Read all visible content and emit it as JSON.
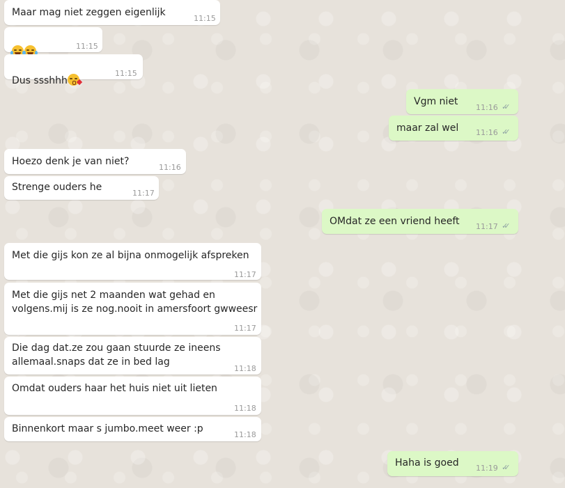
{
  "messages": [
    {
      "dir": "in",
      "text": "Maar mag niet zeggen eigenlijk",
      "time": "11:15"
    },
    {
      "dir": "in",
      "emoji": [
        "face-with-tears-of-joy-icon",
        "face-with-tears-of-joy-icon"
      ],
      "text": "",
      "time": "11:15"
    },
    {
      "dir": "in",
      "text": "Dus ssshhh",
      "emoji_after": "face-blowing-kiss-icon",
      "time": "11:15"
    },
    {
      "dir": "out",
      "text": "Vgm niet",
      "time": "11:16",
      "status": "double-check-icon"
    },
    {
      "dir": "out",
      "text": "maar zal wel",
      "time": "11:16",
      "status": "double-check-icon"
    },
    {
      "dir": "in",
      "text": "Hoezo denk je van niet?",
      "time": "11:16"
    },
    {
      "dir": "in",
      "text": "Strenge ouders he",
      "time": "11:17"
    },
    {
      "dir": "out",
      "text": "OMdat ze een vriend heeft",
      "time": "11:17",
      "status": "double-check-icon"
    },
    {
      "dir": "in",
      "text": "Met die gijs kon ze al bijna onmogelijk afspreken",
      "time": "11:17"
    },
    {
      "dir": "in",
      "text": "Met die gijs net 2 maanden wat gehad en\nvolgens.mij is ze nog.nooit in amersfoort gwweesr",
      "time": "11:17"
    },
    {
      "dir": "in",
      "text": "Die dag dat.ze zou gaan stuurde ze ineens\nallemaal.snaps dat ze in bed lag",
      "time": "11:18"
    },
    {
      "dir": "in",
      "text": "Omdat ouders haar het huis niet uit lieten",
      "time": "11:18"
    },
    {
      "dir": "in",
      "text": "Binnenkort maar s jumbo.meet weer :p",
      "time": "11:18"
    },
    {
      "dir": "out",
      "text": "Haha is goed",
      "time": "11:19",
      "status": "double-check-icon"
    }
  ],
  "colors": {
    "incoming_bubble": "#ffffff",
    "outgoing_bubble": "#dcf8c6",
    "chat_background": "#e7e2db",
    "read_tick": "#8fa3a3"
  }
}
